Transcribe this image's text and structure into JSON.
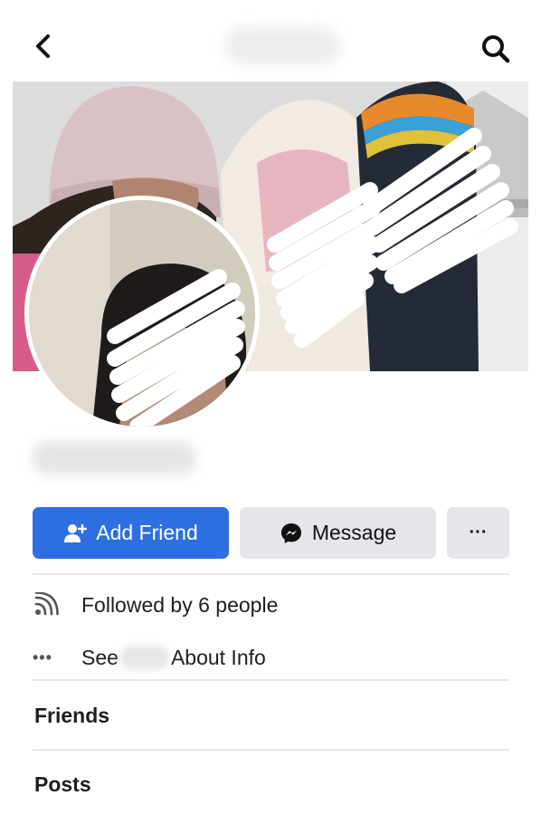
{
  "header": {
    "back_icon": "chevron-left-icon",
    "search_icon": "search-icon"
  },
  "actions": {
    "add_friend_label": "Add Friend",
    "add_friend_icon": "add-person-icon",
    "message_label": "Message",
    "message_icon": "messenger-icon",
    "more_label": "···",
    "add_friend_color": "#2d6fe0",
    "secondary_color": "#e4e6ea"
  },
  "info": {
    "followers_text": "Followed by 6 people",
    "followers_icon": "rss-icon",
    "about_prefix": "See",
    "about_suffix": "About Info",
    "about_icon": "more-dots-icon"
  },
  "sections": {
    "friends_title": "Friends",
    "posts_title": "Posts"
  }
}
